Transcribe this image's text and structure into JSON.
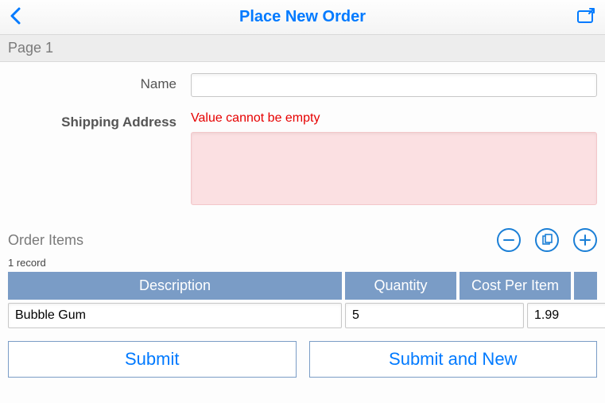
{
  "header": {
    "title": "Place New Order"
  },
  "page_section": "Page 1",
  "form": {
    "name_label": "Name",
    "name_value": "",
    "shipping_label": "Shipping Address",
    "shipping_error": "Value cannot be empty",
    "shipping_value": ""
  },
  "items": {
    "title": "Order Items",
    "record_count": "1 record",
    "columns": {
      "description": "Description",
      "quantity": "Quantity",
      "cost": "Cost Per Item"
    },
    "rows": [
      {
        "description": "Bubble Gum",
        "quantity": "5",
        "cost": "1.99"
      }
    ]
  },
  "buttons": {
    "submit": "Submit",
    "submit_new": "Submit and New"
  }
}
